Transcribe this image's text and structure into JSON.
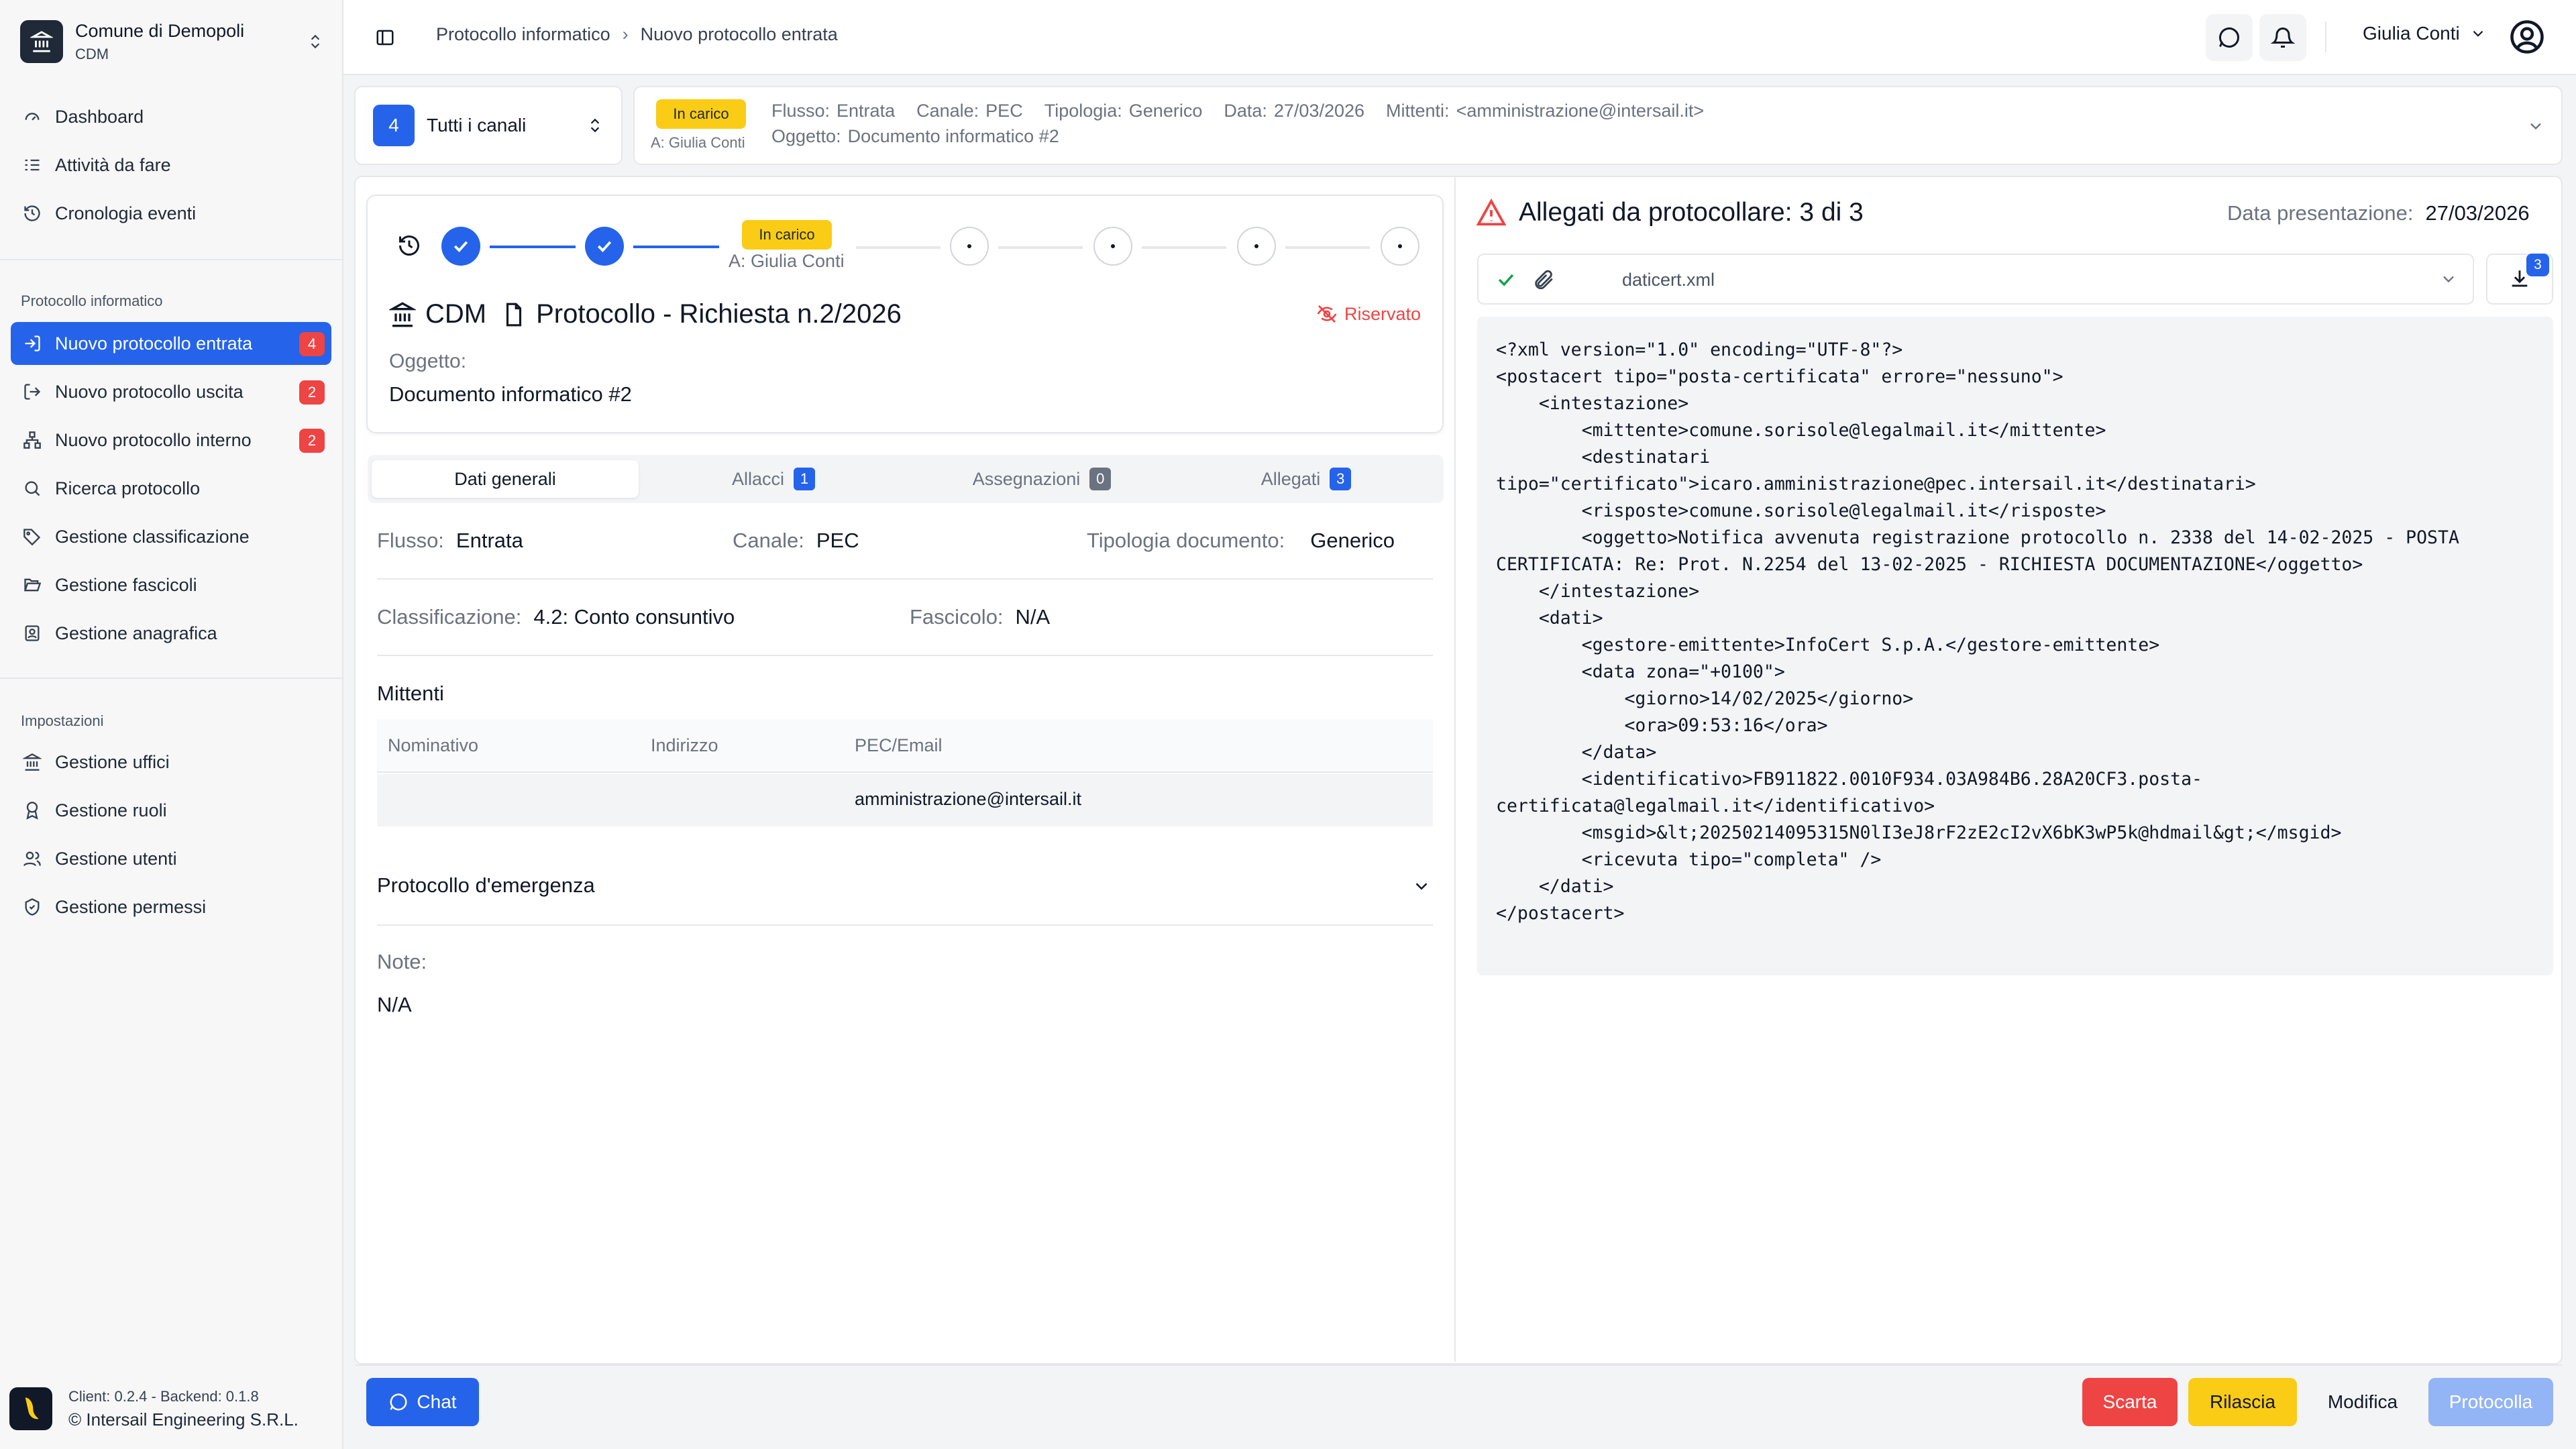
{
  "org": {
    "name": "Comune di Demopoli",
    "code": "CDM"
  },
  "nav": {
    "main": [
      {
        "label": "Dashboard",
        "icon": "dashboard-icon"
      },
      {
        "label": "Attività da fare",
        "icon": "list-todo-icon"
      },
      {
        "label": "Cronologia eventi",
        "icon": "history-icon"
      }
    ],
    "section_protocol": "Protocollo informatico",
    "protocol": [
      {
        "label": "Nuovo protocollo entrata",
        "badge": "4",
        "active": true,
        "icon": "inbox-arrow-icon"
      },
      {
        "label": "Nuovo protocollo uscita",
        "badge": "2",
        "icon": "outbox-arrow-icon"
      },
      {
        "label": "Nuovo protocollo interno",
        "badge": "2",
        "icon": "network-icon"
      },
      {
        "label": "Ricerca protocollo",
        "icon": "search-icon"
      },
      {
        "label": "Gestione classificazione",
        "icon": "tag-icon"
      },
      {
        "label": "Gestione fascicoli",
        "icon": "folder-open-icon"
      },
      {
        "label": "Gestione anagrafica",
        "icon": "contact-icon"
      }
    ],
    "section_settings": "Impostazioni",
    "settings": [
      {
        "label": "Gestione uffici",
        "icon": "landmark-icon"
      },
      {
        "label": "Gestione ruoli",
        "icon": "award-icon"
      },
      {
        "label": "Gestione utenti",
        "icon": "users-icon"
      },
      {
        "label": "Gestione permessi",
        "icon": "shield-check-icon"
      }
    ]
  },
  "footer": {
    "version": "Client: 0.2.4 - Backend: 0.1.8",
    "copyright": "© Intersail Engineering S.R.L."
  },
  "breadcrumb": {
    "parent": "Protocollo informatico",
    "current": "Nuovo protocollo entrata"
  },
  "user": {
    "name": "Giulia Conti"
  },
  "channel": {
    "count": "4",
    "label": "Tutti i canali"
  },
  "summary": {
    "status": "In carico",
    "assignee": "A: Giulia Conti",
    "flusso_k": "Flusso:",
    "flusso_v": "Entrata",
    "canale_k": "Canale:",
    "canale_v": "PEC",
    "tipologia_k": "Tipologia:",
    "tipologia_v": "Generico",
    "data_k": "Data:",
    "data_v": "27/03/2026",
    "mittenti_k": "Mittenti:",
    "mittenti_v": "<amministrazione@intersail.it>",
    "oggetto_k": "Oggetto:",
    "oggetto_v": "Documento informatico #2"
  },
  "stepper": {
    "status": "In carico",
    "assignee": "A: Giulia Conti"
  },
  "protocol": {
    "org": "CDM",
    "title": "Protocollo - Richiesta n.2/2026",
    "reserved": "Riservato",
    "oggetto_label": "Oggetto:",
    "oggetto": "Documento informatico #2"
  },
  "tabs": [
    {
      "label": "Dati generali"
    },
    {
      "label": "Allacci",
      "count": "1"
    },
    {
      "label": "Assegnazioni",
      "count": "0"
    },
    {
      "label": "Allegati",
      "count": "3"
    }
  ],
  "general": {
    "flusso_k": "Flusso:",
    "flusso_v": "Entrata",
    "canale_k": "Canale:",
    "canale_v": "PEC",
    "tipologia_k": "Tipologia documento:",
    "tipologia_v": "Generico",
    "class_k": "Classificazione:",
    "class_v": "4.2: Conto consuntivo",
    "fasc_k": "Fascicolo:",
    "fasc_v": "N/A"
  },
  "mittenti": {
    "title": "Mittenti",
    "columns": [
      "Nominativo",
      "Indirizzo",
      "PEC/Email"
    ],
    "rows": [
      [
        "",
        "",
        "amministrazione@intersail.it"
      ]
    ]
  },
  "emergency": {
    "label": "Protocollo d'emergenza"
  },
  "note": {
    "label": "Note:",
    "value": "N/A"
  },
  "attachments": {
    "title": "Allegati da protocollare: 3 di 3",
    "presentation_k": "Data presentazione:",
    "presentation_v": "27/03/2026",
    "selected_file": "daticert.xml",
    "count": "3",
    "content": "<?xml version=\"1.0\" encoding=\"UTF-8\"?>\n<postacert tipo=\"posta-certificata\" errore=\"nessuno\">\n    <intestazione>\n        <mittente>comune.sorisole@legalmail.it</mittente>\n        <destinatari\ntipo=\"certificato\">icaro.amministrazione@pec.intersail.it</destinatari>\n        <risposte>comune.sorisole@legalmail.it</risposte>\n        <oggetto>Notifica avvenuta registrazione protocollo n. 2338 del 14-02-2025 - POSTA\nCERTIFICATA: Re: Prot. N.2254 del 13-02-2025 - RICHIESTA DOCUMENTAZIONE</oggetto>\n    </intestazione>\n    <dati>\n        <gestore-emittente>InfoCert S.p.A.</gestore-emittente>\n        <data zona=\"+0100\">\n            <giorno>14/02/2025</giorno>\n            <ora>09:53:16</ora>\n        </data>\n        <identificativo>FB911822.0010F934.03A984B6.28A20CF3.posta-\ncertificata@legalmail.it</identificativo>\n        <msgid>&lt;20250214095315N0lI3eJ8rF2zE2cI2vX6bK3wP5k@hdmail&gt;</msgid>\n        <ricevuta tipo=\"completa\" />\n    </dati>\n</postacert>"
  },
  "actions": {
    "chat": "Chat",
    "scarta": "Scarta",
    "rilascia": "Rilascia",
    "modifica": "Modifica",
    "protocolla": "Protocolla"
  },
  "colors": {
    "primary": "#2563eb",
    "danger": "#ef4444",
    "warning": "#facc15",
    "muted": "#6b7280"
  }
}
